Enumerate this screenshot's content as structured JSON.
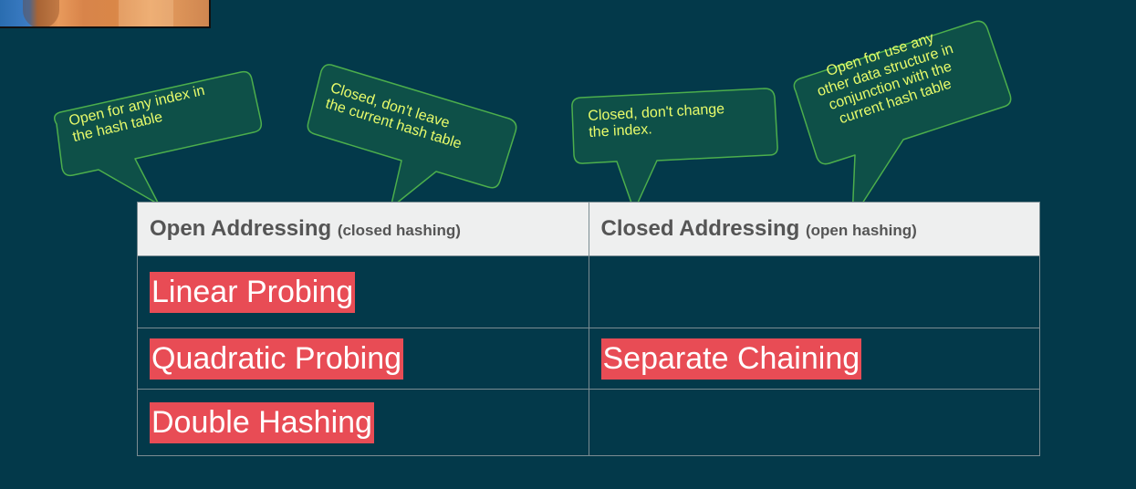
{
  "callouts": [
    {
      "lines": [
        "Open for any index in",
        "the hash table"
      ]
    },
    {
      "lines": [
        "Closed, don't leave",
        "the current hash table"
      ]
    },
    {
      "lines": [
        "Closed, don't change",
        "the index."
      ]
    },
    {
      "lines": [
        "Open for use any",
        "other data structure in",
        "conjunction with the",
        "current hash table"
      ]
    }
  ],
  "table": {
    "col1_header": {
      "title": "Open Addressing",
      "sub": "(closed hashing)"
    },
    "col2_header": {
      "title": "Closed Addressing",
      "sub": "(open hashing)"
    },
    "rows": [
      {
        "col1": "Linear Probing",
        "col2": ""
      },
      {
        "col1": "Quadratic Probing",
        "col2": "Separate Chaining"
      },
      {
        "col1": "Double Hashing",
        "col2": ""
      }
    ]
  },
  "colors": {
    "background": "#03394a",
    "bubble_fill": "#0e5048",
    "bubble_stroke": "#4cae4c",
    "bubble_text": "#e8fb6a",
    "highlight": "#e84c55",
    "header_bg": "#eeefef"
  }
}
